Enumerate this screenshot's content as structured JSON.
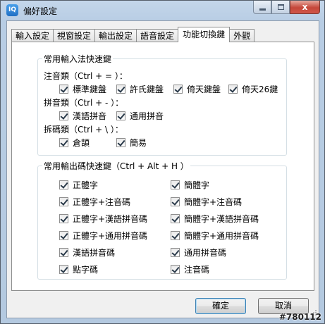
{
  "window": {
    "title": "偏好設定",
    "app_icon_text": "IQ",
    "close_glyph": "x"
  },
  "tabs": [
    {
      "label": "輸入設定",
      "active": false
    },
    {
      "label": "視窗設定",
      "active": false
    },
    {
      "label": "輸出設定",
      "active": false
    },
    {
      "label": "語音設定",
      "active": false
    },
    {
      "label": "功能切換鍵",
      "active": true
    },
    {
      "label": "外觀",
      "active": false
    }
  ],
  "input_group": {
    "title": "常用輸入法快速鍵",
    "categories": [
      {
        "label": "注音類（Ctrl + = ）：",
        "options": [
          {
            "label": "標準鍵盤",
            "checked": true
          },
          {
            "label": "許氏鍵盤",
            "checked": true
          },
          {
            "label": "倚天鍵盤",
            "checked": true
          },
          {
            "label": "倚天26鍵",
            "checked": true
          }
        ]
      },
      {
        "label": "拼音類（Ctrl + - ）：",
        "options": [
          {
            "label": "漢語拼音",
            "checked": true
          },
          {
            "label": "通用拼音",
            "checked": true
          }
        ]
      },
      {
        "label": "拆碼類（Ctrl + \\ ）：",
        "options": [
          {
            "label": "倉頡",
            "checked": true
          },
          {
            "label": "簡易",
            "checked": true
          }
        ]
      }
    ]
  },
  "output_group": {
    "title": "常用輸出碼快速鍵（Ctrl + Alt + H ）",
    "left": [
      {
        "label": "正體字",
        "checked": true
      },
      {
        "label": "正體字+注音碼",
        "checked": true
      },
      {
        "label": "正體字+漢語拼音碼",
        "checked": true
      },
      {
        "label": "正體字+通用拼音碼",
        "checked": true
      },
      {
        "label": "漢語拼音碼",
        "checked": true
      },
      {
        "label": "點字碼",
        "checked": true
      }
    ],
    "right": [
      {
        "label": "簡體字",
        "checked": true
      },
      {
        "label": "簡體字+注音碼",
        "checked": true
      },
      {
        "label": "簡體字+漢語拼音碼",
        "checked": true
      },
      {
        "label": "簡體字+通用拼音碼",
        "checked": true
      },
      {
        "label": "通用拼音碼",
        "checked": true
      },
      {
        "label": "注音碼",
        "checked": true
      }
    ]
  },
  "buttons": {
    "ok": "確定",
    "cancel": "取消"
  },
  "watermark": "#780112"
}
